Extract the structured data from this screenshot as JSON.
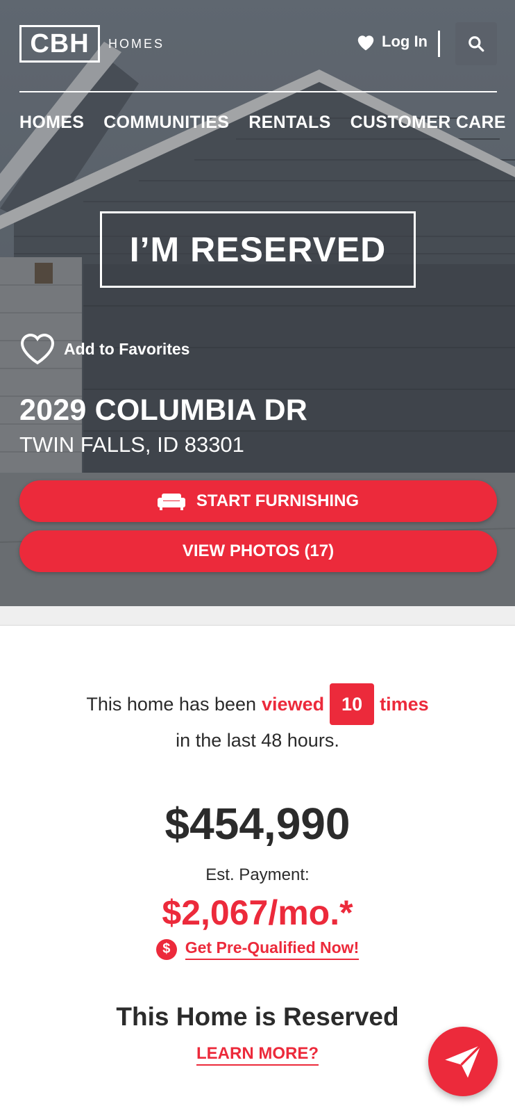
{
  "header": {
    "logo_text": "CBH",
    "logo_sub": "HOMES",
    "login_label": "Log In"
  },
  "nav": {
    "items": [
      "HOMES",
      "COMMUNITIES",
      "RENTALS",
      "CUSTOMER CARE"
    ]
  },
  "hero": {
    "badge": "I’M RESERVED",
    "favorites_label": "Add to Favorites",
    "address": "2029 COLUMBIA DR",
    "city": "TWIN FALLS, ID 83301",
    "furnish_label": "START FURNISHING",
    "photos_label": "VIEW PHOTOS (17)"
  },
  "views": {
    "prefix": "This home has been",
    "viewed_word": "viewed",
    "count": "10",
    "times_word": "times",
    "suffix": "in the last 48 hours."
  },
  "pricing": {
    "price": "$454,990",
    "est_label": "Est. Payment:",
    "est_amount": "$2,067/mo.*",
    "prequal_icon": "$",
    "prequal_label": "Get Pre-Qualified Now!"
  },
  "status": {
    "title": "This Home is Reserved",
    "learn_more": "LEARN MORE?"
  },
  "colors": {
    "accent": "#ec2a3b",
    "text": "#2b2b2b"
  },
  "icons": [
    "heart-icon",
    "search-icon",
    "heart-outline-icon",
    "sofa-icon",
    "dollar-icon",
    "paper-plane-icon"
  ]
}
